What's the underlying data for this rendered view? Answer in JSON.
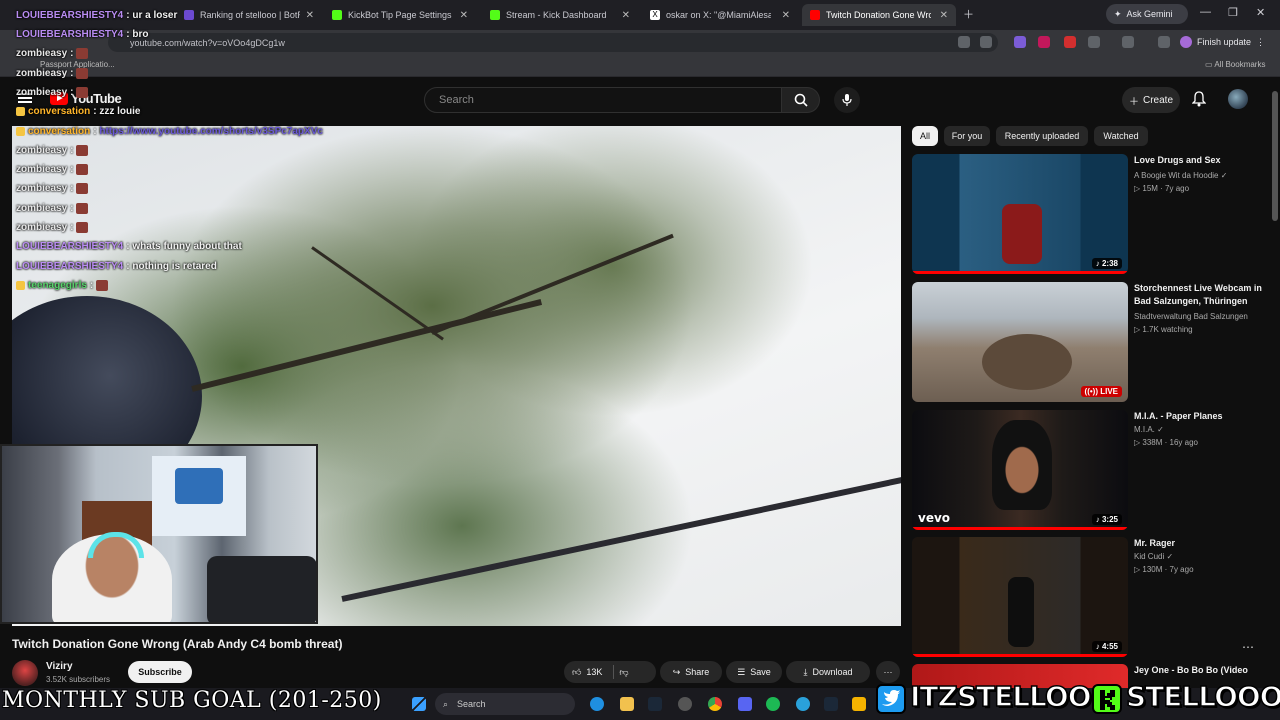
{
  "browser": {
    "tabs": [
      {
        "label": "Ranking of stellooo | BotRix",
        "color": "#6c4ad1"
      },
      {
        "label": "KickBot Tip Page Settings",
        "color": "#53fc18"
      },
      {
        "label": "Stream - Kick Dashboard",
        "color": "#53fc18"
      },
      {
        "label": "oskar on X: \"@MiamiAlesandro",
        "color": "#ffffff"
      },
      {
        "label": "Twitch Donation Gone Wrong (",
        "color": "#ff0000"
      }
    ],
    "ask_gemini": "Ask Gemini",
    "url": "youtube.com/watch?v=oVOo4gDCg1w",
    "finish_update": "Finish update",
    "bookmark_passport": "Passport Applicatio...",
    "all_bookmarks": "All Bookmarks"
  },
  "youtube": {
    "logo": "YouTube",
    "search_placeholder": "Search",
    "create": "Create",
    "video_title": "Twitch Donation Gone Wrong (Arab Andy C4 bomb threat)",
    "channel": "Viziry",
    "subscribers": "3.52K subscribers",
    "subscribe": "Subscribe",
    "likes": "13K",
    "share": "Share",
    "save": "Save",
    "download": "Download",
    "chips": [
      "All",
      "For you",
      "Recently uploaded",
      "Watched"
    ],
    "recommendations": [
      {
        "title": "Love Drugs and Sex",
        "channel": "A Boogie Wit da Hoodie",
        "meta": "15M · 7y ago",
        "duration": "2:38"
      },
      {
        "title": "Storchennest Live Webcam in Bad Salzungen, Thüringen",
        "channel": "Stadtverwaltung Bad Salzungen",
        "meta": "1.7K watching",
        "duration": "LIVE"
      },
      {
        "title": "M.I.A. - Paper Planes",
        "channel": "M.I.A.",
        "meta": "338M · 16y ago",
        "duration": "3:25"
      },
      {
        "title": "Mr. Rager",
        "channel": "Kid Cudi",
        "meta": "130M · 7y ago",
        "duration": "4:55"
      },
      {
        "title": "Jey One - Bo Bo Bo (Video",
        "channel": "",
        "meta": "",
        "duration": ""
      }
    ]
  },
  "chat": [
    {
      "user": "LOUIEBEARSHIESTY4",
      "msg": "ur a loser",
      "cls": "c-louie"
    },
    {
      "user": "LOUIEBEARSHIESTY4",
      "msg": "bro",
      "cls": "c-louie"
    },
    {
      "user": "zombieasy",
      "msg": "",
      "cls": "c-zomb"
    },
    {
      "user": "zombieasy",
      "msg": "",
      "cls": "c-zomb"
    },
    {
      "user": "zombieasy",
      "msg": "",
      "cls": "c-zomb"
    },
    {
      "user": "conversation",
      "msg": "zzz louie",
      "cls": "c-conv"
    },
    {
      "user": "conversation",
      "msg": "https://www.youtube.com/shorts/v3SPc7apXVc",
      "cls": "c-conv"
    },
    {
      "user": "zombieasy",
      "msg": "",
      "cls": "c-zomb"
    },
    {
      "user": "zombieasy",
      "msg": "",
      "cls": "c-zomb"
    },
    {
      "user": "zombieasy",
      "msg": "",
      "cls": "c-zomb"
    },
    {
      "user": "zombieasy",
      "msg": "",
      "cls": "c-zomb"
    },
    {
      "user": "zombieasy",
      "msg": "",
      "cls": "c-zomb"
    },
    {
      "user": "LOUIEBEARSHIESTY4",
      "msg": "whats funny about that",
      "cls": "c-louie"
    },
    {
      "user": "LOUIEBEARSHIESTY4",
      "msg": "nothing is retared",
      "cls": "c-louie"
    },
    {
      "user": "teenagegirls",
      "msg": "",
      "cls": "c-teen"
    }
  ],
  "taskbar": {
    "search": "Search"
  },
  "overlay": {
    "goal": "MONTHLY SUB GOAL (201-250)",
    "twitter_handle": "ITZSTELLOO",
    "kick_handle": "STELLOOO",
    "twitter_color": "#1d9bf0",
    "kick_color": "#53fc18"
  }
}
